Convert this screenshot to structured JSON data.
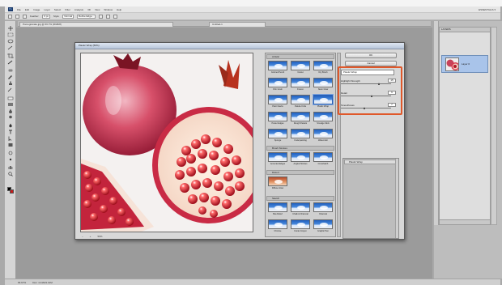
{
  "menubar": {
    "app_logo": "Ps",
    "items": [
      "File",
      "Edit",
      "Image",
      "Layer",
      "Select",
      "Filter",
      "Analysis",
      "3D",
      "View",
      "Window",
      "Help"
    ],
    "workspace": "ESSENTIALS ▾"
  },
  "options": {
    "feather_label": "Feather:",
    "feather_value": "0 px",
    "style_label": "Style:",
    "style_value": "Normal",
    "refine_label": "Refine Edge..."
  },
  "document": {
    "tab_title": "Pomegranate.jpg @ 66.7% (RGB/8)",
    "tab2_title": "Untitled-1"
  },
  "filter_gallery": {
    "title": "Plastic Wrap (50%)",
    "zoom": "50%",
    "ok_label": "OK",
    "cancel_label": "Cancel",
    "filter_select": "Plastic Wrap",
    "params": [
      {
        "label": "Highlight Strength",
        "value": "15",
        "pos": 0.75
      },
      {
        "label": "Detail",
        "value": "9",
        "pos": 0.6
      },
      {
        "label": "Smoothness",
        "value": "7",
        "pos": 0.45
      }
    ],
    "effect_layer": "Plastic Wrap",
    "folders": [
      "Artistic",
      "Brush Strokes",
      "Distort",
      "Sketch"
    ],
    "artistic_thumbs": [
      "Colored Pencil",
      "Cutout",
      "Dry Brush",
      "Film Grain",
      "Fresco",
      "Neon Glow",
      "Paint Daubs",
      "Palette Knife",
      "Plastic Wrap",
      "Poster Edges",
      "Rough Pastels",
      "Smudge Stick",
      "Sponge",
      "Underpainting",
      "Watercolor"
    ],
    "brush_thumbs": [
      "Accented Edges",
      "Angled Strokes",
      "Crosshatch"
    ],
    "distort_thumbs": [
      "Diffuse Glow"
    ],
    "sketch_thumbs": [
      "Bas Relief",
      "Chalk & Charcoal",
      "Charcoal",
      "Chrome",
      "Conte Crayon",
      "Graphic Pen"
    ]
  },
  "layers_panel": {
    "title": "LAYERS",
    "layer_name": "Layer 0"
  },
  "status": {
    "zoom": "66.67%",
    "doc_size": "Doc: 4.41M/4.41M"
  },
  "colors": {
    "accent_highlight": "#e0582a",
    "foreground": "#000000",
    "background": "#c71a1a"
  }
}
